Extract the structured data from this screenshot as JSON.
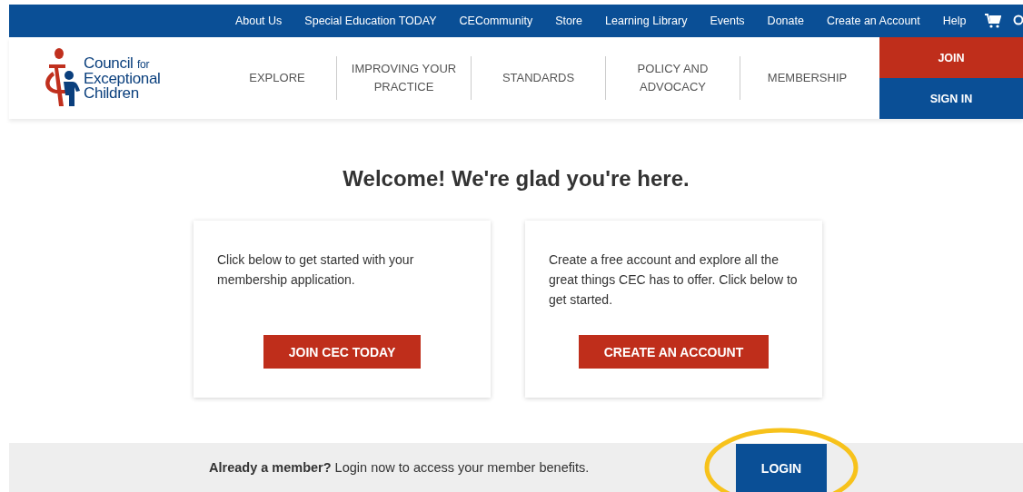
{
  "top_nav": {
    "links": [
      "About Us",
      "Special Education TODAY",
      "CECommunity",
      "Store",
      "Learning Library",
      "Events",
      "Donate",
      "Create an Account",
      "Help"
    ]
  },
  "header": {
    "logo": {
      "line_1": "Council",
      "line_1_small": "for",
      "line_2": "Exceptional",
      "line_3": "Children"
    },
    "menu": [
      {
        "label": "EXPLORE"
      },
      {
        "label": "IMPROVING YOUR PRACTICE"
      },
      {
        "label": "STANDARDS"
      },
      {
        "label": "POLICY AND ADVOCACY"
      },
      {
        "label": "MEMBERSHIP"
      }
    ],
    "join": "JOIN",
    "sign_in": "SIGN IN"
  },
  "heading": "Welcome! We're glad you're here.",
  "cards": [
    {
      "text": "Click below to get started with your membership application.",
      "button": "JOIN CEC TODAY"
    },
    {
      "text": "Create a free account and explore all the great things CEC has to offer. Click below to get started.",
      "button": "CREATE AN ACCOUNT"
    }
  ],
  "member_bar": {
    "text": "**Already a member?** Login now to access your member benefits.",
    "button": "LOGIN",
    "highlighted": true
  }
}
